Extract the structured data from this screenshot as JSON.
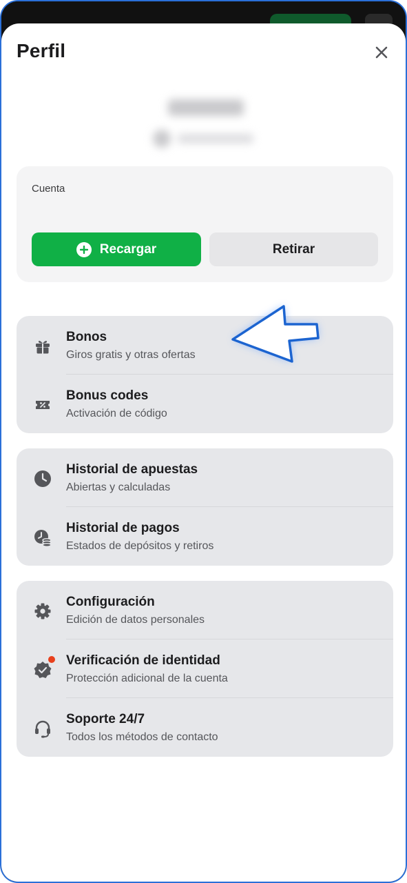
{
  "header": {
    "title": "Perfil"
  },
  "account": {
    "label": "Cuenta",
    "recharge_label": "Recargar",
    "withdraw_label": "Retirar"
  },
  "groups": [
    {
      "items": [
        {
          "title": "Bonos",
          "subtitle": "Giros gratis y otras ofertas",
          "icon": "gift-icon"
        },
        {
          "title": "Bonus codes",
          "subtitle": "Activación de código",
          "icon": "coupon-icon"
        }
      ]
    },
    {
      "items": [
        {
          "title": "Historial de apuestas",
          "subtitle": "Abiertas y calculadas",
          "icon": "clock-icon"
        },
        {
          "title": "Historial de pagos",
          "subtitle": "Estados de depósitos y retiros",
          "icon": "payment-history-icon"
        }
      ]
    },
    {
      "items": [
        {
          "title": "Configuración",
          "subtitle": "Edición de datos personales",
          "icon": "gear-icon"
        },
        {
          "title": "Verificación de identidad",
          "subtitle": "Protección adicional de la cuenta",
          "icon": "verified-badge-icon"
        },
        {
          "title": "Soporte 24/7",
          "subtitle": "Todos los métodos de contacto",
          "icon": "headset-icon"
        }
      ]
    }
  ],
  "colors": {
    "accent_green": "#10b046",
    "notification_dot": "#e8401c",
    "pointer_blue": "#1c64d0"
  }
}
